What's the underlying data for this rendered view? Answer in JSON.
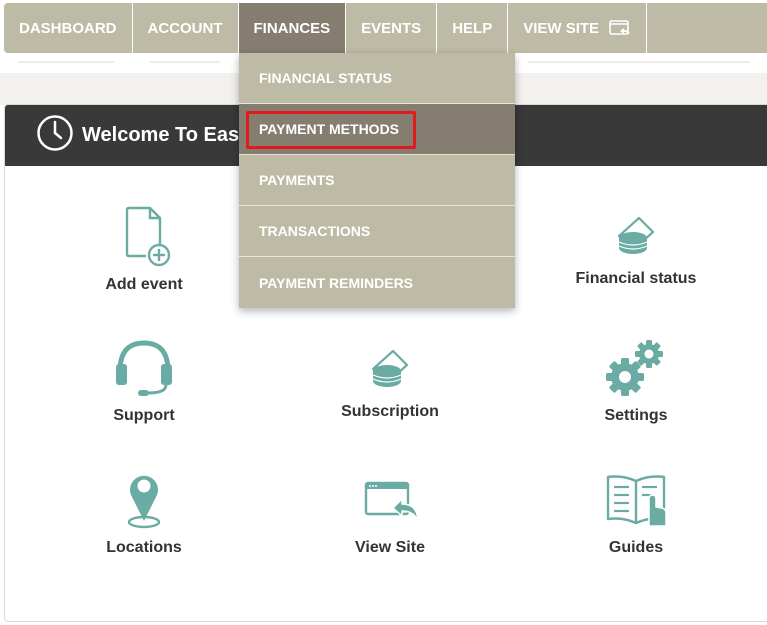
{
  "nav": {
    "items": [
      {
        "label": "DASHBOARD"
      },
      {
        "label": "ACCOUNT"
      },
      {
        "label": "FINANCES",
        "active": true
      },
      {
        "label": "EVENTS"
      },
      {
        "label": "HELP"
      },
      {
        "label": "VIEW SITE",
        "icon": "view-site-icon"
      }
    ]
  },
  "dropdown": {
    "items": [
      {
        "label": "FINANCIAL STATUS"
      },
      {
        "label": "PAYMENT METHODS",
        "hovered": true
      },
      {
        "label": "PAYMENTS"
      },
      {
        "label": "TRANSACTIONS"
      },
      {
        "label": "PAYMENT REMINDERS"
      }
    ]
  },
  "panel": {
    "title": "Welcome To Easy",
    "icon": "clock-icon"
  },
  "tiles": [
    {
      "label": "Add event",
      "icon": "add-document-icon"
    },
    {
      "label": "Financial status",
      "icon": "money-stack-icon"
    },
    {
      "label": "Support",
      "icon": "headset-icon"
    },
    {
      "label": "Subscription",
      "icon": "money-stack-icon"
    },
    {
      "label": "Settings",
      "icon": "gears-icon"
    },
    {
      "label": "Locations",
      "icon": "map-pin-icon"
    },
    {
      "label": "View Site",
      "icon": "browser-share-icon"
    },
    {
      "label": "Guides",
      "icon": "book-hand-icon"
    }
  ],
  "colors": {
    "nav_bg": "#bdbba5",
    "nav_active": "#857e70",
    "header_bg": "#393939",
    "icon_teal": "#6aaba4",
    "highlight": "#e01b1b"
  }
}
